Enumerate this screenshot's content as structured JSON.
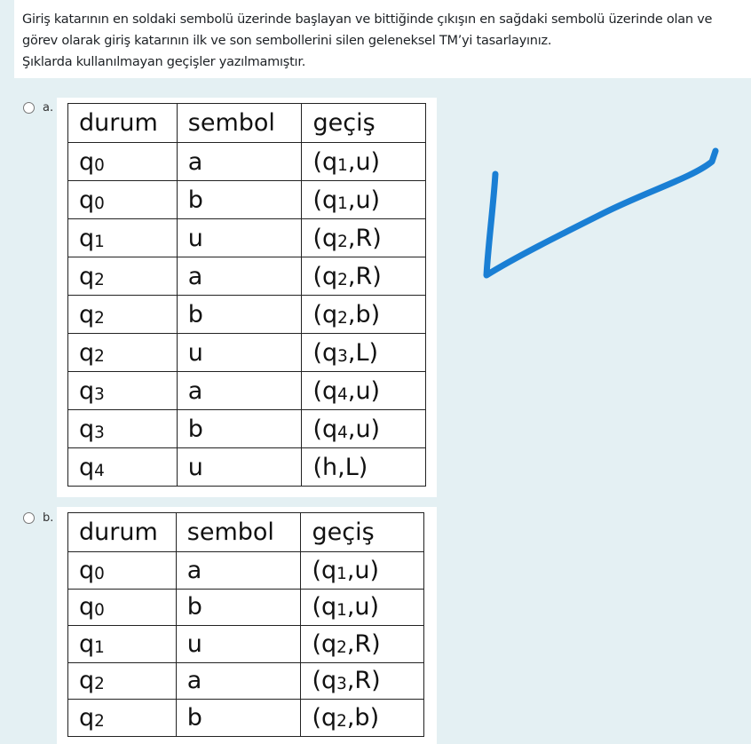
{
  "question": {
    "line1": "Giriş katarının en soldaki sembolü üzerinde başlayan ve bittiğinde çıkışın en sağdaki sembolü üzerinde olan ve",
    "line2": "görev olarak giriş katarının ilk ve son sembollerini silen geleneksel TM’yi tasarlayınız.",
    "line3": "Şıklarda kullanılmayan geçişler yazılmamıştır."
  },
  "options": [
    {
      "label": "a.",
      "headers": [
        "durum",
        "sembol",
        "geçiş"
      ],
      "rows": [
        {
          "state": "q",
          "state_sub": "0",
          "symbol": "a",
          "trans_pre": "(q",
          "trans_sub": "1",
          "trans_post": ",u)"
        },
        {
          "state": "q",
          "state_sub": "0",
          "symbol": "b",
          "trans_pre": "(q",
          "trans_sub": "1",
          "trans_post": ",u)"
        },
        {
          "state": "q",
          "state_sub": "1",
          "symbol": "u",
          "trans_pre": "(q",
          "trans_sub": "2",
          "trans_post": ",R)"
        },
        {
          "state": "q",
          "state_sub": "2",
          "symbol": "a",
          "trans_pre": "(q",
          "trans_sub": "2",
          "trans_post": ",R)"
        },
        {
          "state": "q",
          "state_sub": "2",
          "symbol": "b",
          "trans_pre": "(q",
          "trans_sub": "2",
          "trans_post": ",b)"
        },
        {
          "state": "q",
          "state_sub": "2",
          "symbol": "u",
          "trans_pre": "(q",
          "trans_sub": "3",
          "trans_post": ",L)"
        },
        {
          "state": "q",
          "state_sub": "3",
          "symbol": "a",
          "trans_pre": "(q",
          "trans_sub": "4",
          "trans_post": ",u)"
        },
        {
          "state": "q",
          "state_sub": "3",
          "symbol": "b",
          "trans_pre": "(q",
          "trans_sub": "4",
          "trans_post": ",u)"
        },
        {
          "state": "q",
          "state_sub": "4",
          "symbol": "u",
          "trans_pre": "(h,L)",
          "trans_sub": "",
          "trans_post": ""
        }
      ]
    },
    {
      "label": "b.",
      "headers": [
        "durum",
        "sembol",
        "geçiş"
      ],
      "rows": [
        {
          "state": "q",
          "state_sub": "0",
          "symbol": "a",
          "trans_pre": "(q",
          "trans_sub": "1",
          "trans_post": ",u)"
        },
        {
          "state": "q",
          "state_sub": "0",
          "symbol": "b",
          "trans_pre": "(q",
          "trans_sub": "1",
          "trans_post": ",u)"
        },
        {
          "state": "q",
          "state_sub": "1",
          "symbol": "u",
          "trans_pre": "(q",
          "trans_sub": "2",
          "trans_post": ",R)"
        },
        {
          "state": "q",
          "state_sub": "2",
          "symbol": "a",
          "trans_pre": "(q",
          "trans_sub": "3",
          "trans_post": ",R)"
        },
        {
          "state": "q",
          "state_sub": "2",
          "symbol": "b",
          "trans_pre": "(q",
          "trans_sub": "2",
          "trans_post": ",b)"
        }
      ]
    }
  ],
  "annotation": {
    "icon": "handwritten-checkmark-icon",
    "color": "#1a7fd4"
  },
  "colors": {
    "page_bg": "#e4f0f3",
    "text": "#1d2125",
    "table_border": "#222222"
  }
}
